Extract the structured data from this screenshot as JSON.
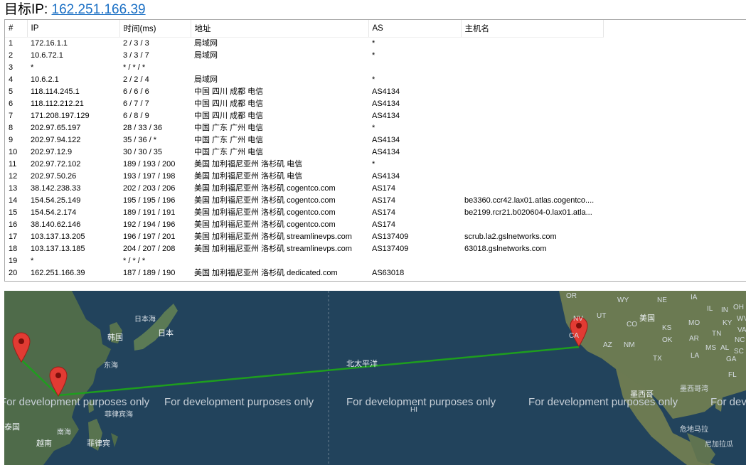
{
  "header": {
    "label": "目标IP: ",
    "ip": "162.251.166.39"
  },
  "table": {
    "columns": [
      "#",
      "IP",
      "时间(ms)",
      "地址",
      "AS",
      "主机名"
    ],
    "rows": [
      [
        "1",
        "172.16.1.1",
        "2 / 3 / 3",
        "局域网",
        "*",
        ""
      ],
      [
        "2",
        "10.6.72.1",
        "3 / 3 / 7",
        "局域网",
        "*",
        ""
      ],
      [
        "3",
        "*",
        "* / * / *",
        "",
        "",
        ""
      ],
      [
        "4",
        "10.6.2.1",
        "2 / 2 / 4",
        "局域网",
        "*",
        ""
      ],
      [
        "5",
        "118.114.245.1",
        "6 / 6 / 6",
        "中国 四川 成都 电信",
        "AS4134",
        ""
      ],
      [
        "6",
        "118.112.212.21",
        "6 / 7 / 7",
        "中国 四川 成都 电信",
        "AS4134",
        ""
      ],
      [
        "7",
        "171.208.197.129",
        "6 / 8 / 9",
        "中国 四川 成都 电信",
        "AS4134",
        ""
      ],
      [
        "8",
        "202.97.65.197",
        "28 / 33 / 36",
        "中国 广东 广州 电信",
        "*",
        ""
      ],
      [
        "9",
        "202.97.94.122",
        "35 / 36 / *",
        "中国 广东 广州 电信",
        "AS4134",
        ""
      ],
      [
        "10",
        "202.97.12.9",
        "30 / 30 / 35",
        "中国 广东 广州 电信",
        "AS4134",
        ""
      ],
      [
        "11",
        "202.97.72.102",
        "189 / 193 / 200",
        "美国 加利福尼亚州 洛杉矶 电信",
        "*",
        ""
      ],
      [
        "12",
        "202.97.50.26",
        "193 / 197 / 198",
        "美国 加利福尼亚州 洛杉矶 电信",
        "AS4134",
        ""
      ],
      [
        "13",
        "38.142.238.33",
        "202 / 203 / 206",
        "美国 加利福尼亚州 洛杉矶 cogentco.com",
        "AS174",
        ""
      ],
      [
        "14",
        "154.54.25.149",
        "195 / 195 / 196",
        "美国 加利福尼亚州 洛杉矶 cogentco.com",
        "AS174",
        "be3360.ccr42.lax01.atlas.cogentco...."
      ],
      [
        "15",
        "154.54.2.174",
        "189 / 191 / 191",
        "美国 加利福尼亚州 洛杉矶 cogentco.com",
        "AS174",
        "be2199.rcr21.b020604-0.lax01.atla..."
      ],
      [
        "16",
        "38.140.62.146",
        "192 / 194 / 196",
        "美国 加利福尼亚州 洛杉矶 cogentco.com",
        "AS174",
        ""
      ],
      [
        "17",
        "103.137.13.205",
        "196 / 197 / 201",
        "美国 加利福尼亚州 洛杉矶 streamlinevps.com",
        "AS137409",
        "scrub.la2.gslnetworks.com"
      ],
      [
        "18",
        "103.137.13.185",
        "204 / 207 / 208",
        "美国 加利福尼亚州 洛杉矶 streamlinevps.com",
        "AS137409",
        "63018.gslnetworks.com"
      ],
      [
        "19",
        "*",
        "* / * / *",
        "",
        "",
        ""
      ],
      [
        "20",
        "162.251.166.39",
        "187 / 189 / 190",
        "美国 加利福尼亚州 洛杉矶 dedicated.com",
        "AS63018",
        ""
      ]
    ]
  },
  "map": {
    "labels": {
      "japan_sea": "日本海",
      "korea": "韩国",
      "japan": "日本",
      "east_sea": "东海",
      "south_sea": "南海",
      "philippine_sea": "菲律宾海",
      "thailand": "泰国",
      "vietnam": "越南",
      "philippines": "菲律宾",
      "pacific": "北太平洋",
      "hawaii": "HI",
      "usa": "美国",
      "mexico": "墨西哥",
      "gulf": "墨西哥湾",
      "guatemala": "危地马拉",
      "nicaragua": "尼加拉瓜",
      "or": "OR",
      "wy": "WY",
      "ne": "NE",
      "nv": "NV",
      "ut": "UT",
      "co": "CO",
      "ks": "KS",
      "ca": "CA",
      "az": "AZ",
      "nm": "NM",
      "ok": "OK",
      "tx": "TX",
      "ia": "IA",
      "mo": "MO",
      "ar": "AR",
      "la": "LA",
      "ms": "MS",
      "al": "AL",
      "tn": "TN",
      "ky": "KY",
      "il": "IL",
      "in": "IN",
      "oh": "OH",
      "wv": "WV",
      "va": "VA",
      "nc": "NC",
      "sc": "SC",
      "ga": "GA",
      "fl": "FL"
    },
    "watermark": "For development purposes only",
    "route_color": "#1e9e1e",
    "pin_color": "#e23b33"
  }
}
